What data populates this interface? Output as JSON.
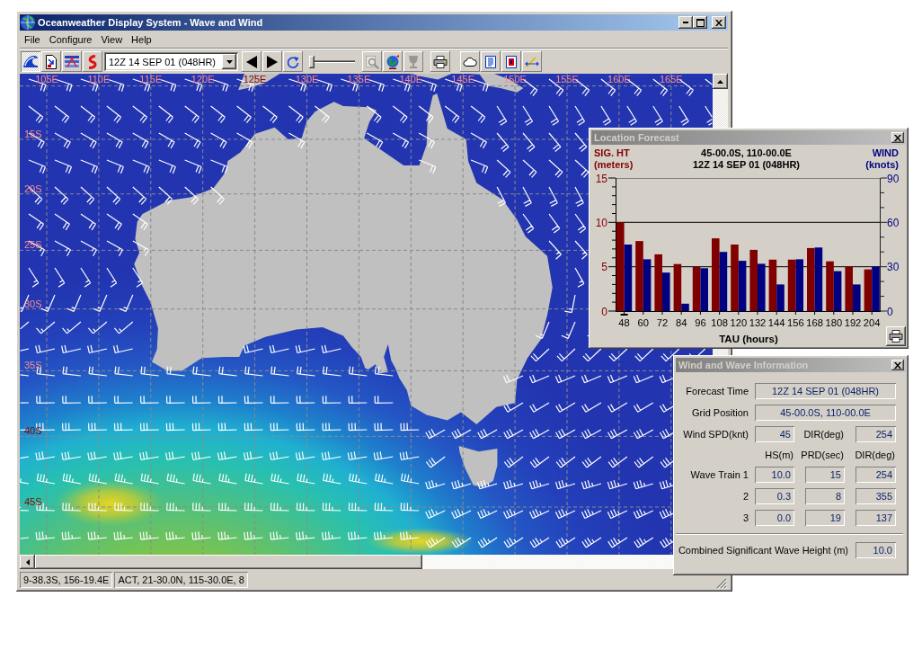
{
  "window": {
    "title": "Oceanweather Display System - Wave and Wind"
  },
  "menu": [
    {
      "label": "File"
    },
    {
      "label": "Configure"
    },
    {
      "label": "View"
    },
    {
      "label": "Help"
    }
  ],
  "toolbar": {
    "layer_buttons": [
      {
        "pressed": true
      },
      {
        "pressed": false
      },
      {
        "pressed": false
      },
      {
        "pressed": false
      }
    ],
    "time_select": {
      "value": "12Z 14 SEP 01 (048HR)"
    },
    "animation_speed": {
      "level": 0
    },
    "tool_groups": [
      {
        "buttons": [
          {
            "disabled": true
          },
          {
            "disabled": false
          },
          {
            "disabled": true
          }
        ]
      },
      {
        "buttons": [
          {
            "disabled": false
          }
        ]
      },
      {
        "buttons": [
          {
            "disabled": false
          },
          {
            "disabled": false
          },
          {
            "disabled": false
          },
          {
            "disabled": false
          }
        ]
      }
    ]
  },
  "map": {
    "longitude_labels": [
      "105E",
      "110E",
      "115E",
      "120E",
      "125E",
      "130E",
      "135E",
      "140E",
      "145E",
      "150E",
      "155E",
      "160E",
      "165E"
    ],
    "latitude_labels": [
      "15S",
      "20S",
      "25S",
      "30S",
      "35S",
      "40S",
      "45S"
    ]
  },
  "status_bar": {
    "panes": [
      "9-38.3S, 156-19.4E",
      "ACT, 21-30.0N, 115-30.0E, 8"
    ]
  },
  "location_forecast": {
    "title": "Location Forecast",
    "position": "45-00.0S, 110-00.0E",
    "time": "12Z 14 SEP 01 (048HR)",
    "series_units": [
      "(meters)",
      "(knots)"
    ],
    "tau_selection": [
      {
        "selected": true
      },
      {
        "selected": false
      },
      {
        "selected": false
      },
      {
        "selected": false
      },
      {
        "selected": false
      },
      {
        "selected": false
      },
      {
        "selected": false
      },
      {
        "selected": false
      },
      {
        "selected": false
      },
      {
        "selected": false
      },
      {
        "selected": false
      },
      {
        "selected": false
      },
      {
        "selected": false
      },
      {
        "selected": false
      }
    ],
    "chart_data": {
      "type": "bar",
      "xlabel": "TAU (hours)",
      "categories": [
        "48",
        "60",
        "72",
        "84",
        "96",
        "108",
        "120",
        "132",
        "144",
        "156",
        "168",
        "180",
        "192",
        "204"
      ],
      "series": [
        {
          "name": "SIG. HT",
          "color": "#800000",
          "values": [
            10.0,
            7.9,
            6.4,
            5.3,
            5.0,
            8.2,
            7.5,
            6.9,
            5.8,
            5.8,
            7.1,
            5.6,
            5.0,
            4.7
          ]
        },
        {
          "name": "WIND",
          "axis": "y2",
          "color": "#000080",
          "values": [
            45,
            35,
            26,
            5,
            29,
            40,
            34,
            32,
            18,
            35,
            43,
            27,
            18,
            30
          ]
        }
      ],
      "ylim": [
        0,
        15
      ],
      "yticks": [
        0,
        5,
        10,
        15
      ],
      "y2lim": [
        0,
        90
      ],
      "y2ticks": [
        0,
        30,
        60,
        90
      ]
    }
  },
  "wind_wave_info": {
    "title": "Wind and Wave Information",
    "forecast_time": {
      "label": "Forecast Time",
      "value": "12Z 14 SEP 01 (048HR)"
    },
    "grid_position": {
      "label": "Grid Position",
      "value": "45-00.0S, 110-00.0E"
    },
    "wind": {
      "speed_label": "Wind SPD(knt)",
      "speed": "45",
      "direction_label": "DIR(deg)",
      "direction": "254"
    },
    "wave_columns": [
      "HS(m)",
      "PRD(sec)",
      "DIR(deg)"
    ],
    "wave_trains": [
      {
        "label": "Wave Train 1",
        "values": [
          "10.0",
          "15",
          "254"
        ]
      },
      {
        "label": "2",
        "values": [
          "0.3",
          "8",
          "355"
        ]
      },
      {
        "label": "3",
        "values": [
          "0.0",
          "19",
          "137"
        ]
      }
    ],
    "combined": {
      "label": "Combined Significant Wave Height (m)",
      "value": "10.0"
    }
  }
}
